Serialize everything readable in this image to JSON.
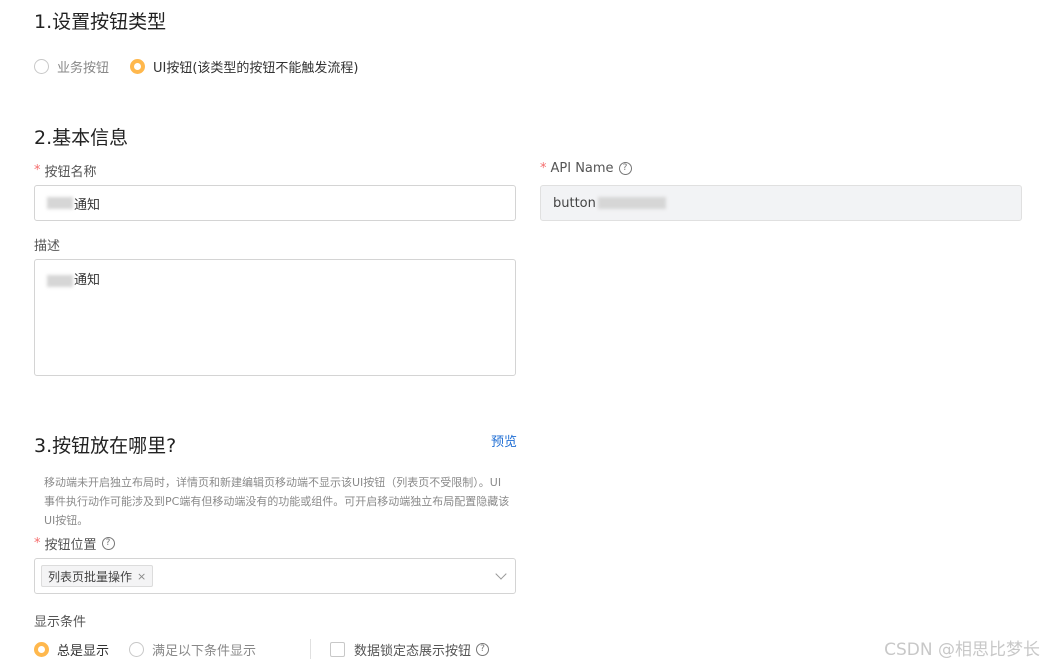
{
  "section1": {
    "title": "1.设置按钮类型",
    "options": [
      "业务按钮",
      "UI按钮(该类型的按钮不能触发流程)"
    ]
  },
  "section2": {
    "title": "2.基本信息",
    "button_name_label": "按钮名称",
    "button_name_value": "通知",
    "api_name_label": "API Name",
    "api_name_value": "button",
    "description_label": "描述",
    "description_value": "通知"
  },
  "section3": {
    "title": "3.按钮放在哪里?",
    "preview_link": "预览",
    "hint": "移动端未开启独立布局时，详情页和新建编辑页移动端不显示该UI按钮（列表页不受限制）。UI事件执行动作可能涉及到PC端有但移动端没有的功能或组件。可开启移动端独立布局配置隐藏该UI按钮。",
    "position_label": "按钮位置",
    "position_tag": "列表页批量操作",
    "tag_close": "×",
    "display_condition_label": "显示条件",
    "display_options": [
      "总是显示",
      "满足以下条件显示"
    ],
    "lock_checkbox_label": "数据锁定态展示按钮"
  },
  "required_mark": "*",
  "help_glyph": "?",
  "watermark": "CSDN @相思比梦长",
  "colors": {
    "accent_radio": "#ffb84d",
    "link": "#1f6ed4",
    "required": "#f56c6c"
  }
}
